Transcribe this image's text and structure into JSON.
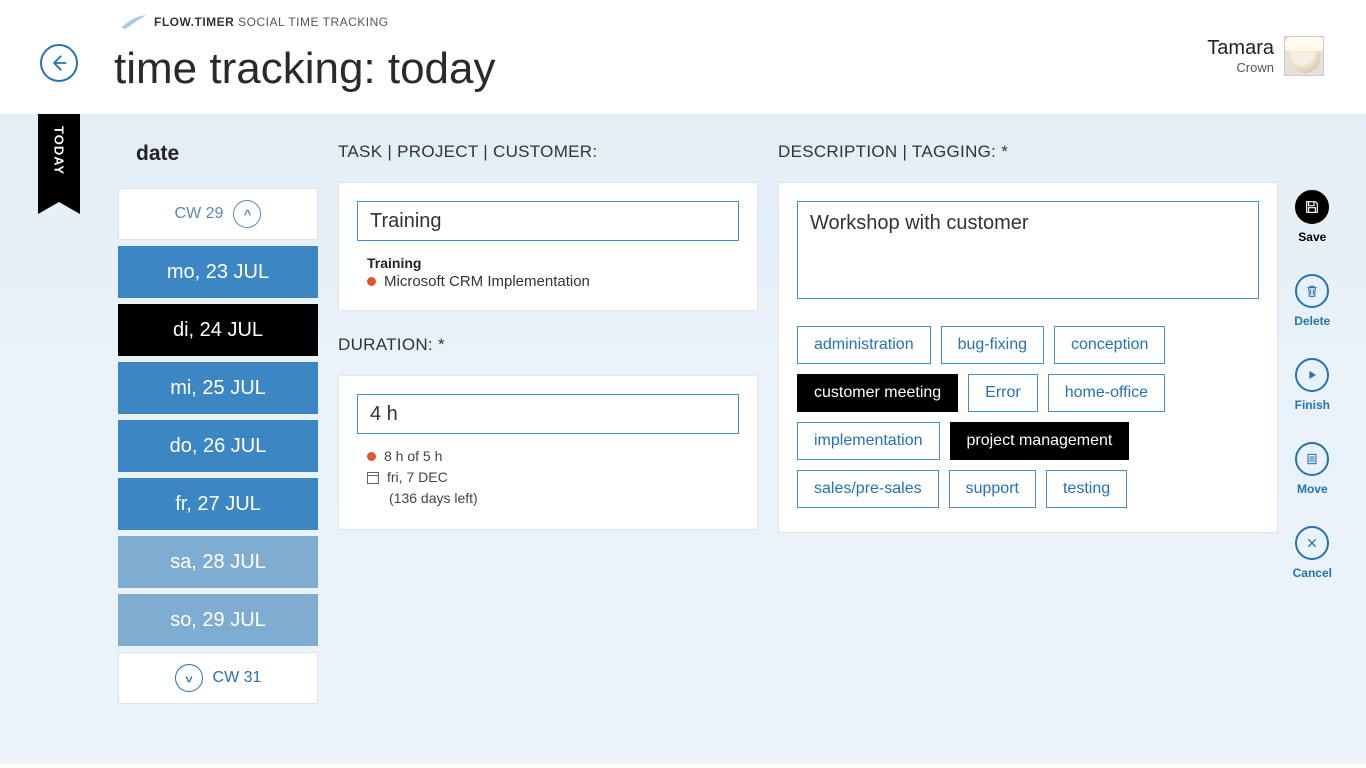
{
  "brand": {
    "name_bold": "FLOW.TIMER",
    "name_light": " SOCIAL TIME TRACKING"
  },
  "page_title": "time tracking: today",
  "user": {
    "name": "Tamara",
    "company": "Crown"
  },
  "today_label": "TODAY",
  "date_section": {
    "heading": "date",
    "prev_week": "CW 29",
    "next_week": "CW 31",
    "days": [
      {
        "label": "mo, 23 JUL",
        "style": "blue"
      },
      {
        "label": "di, 24 JUL",
        "style": "active"
      },
      {
        "label": "mi, 25 JUL",
        "style": "blue"
      },
      {
        "label": "do, 26 JUL",
        "style": "blue"
      },
      {
        "label": "fr, 27 JUL",
        "style": "blue"
      },
      {
        "label": "sa, 28 JUL",
        "style": "light"
      },
      {
        "label": "so, 29 JUL",
        "style": "light"
      }
    ]
  },
  "task_section": {
    "heading": "TASK | PROJECT | CUSTOMER:",
    "input_value": "Training",
    "task_name": "Training",
    "project_name": "Microsoft CRM Implementation"
  },
  "duration_section": {
    "heading": "DURATION: *",
    "input_value": "4 h",
    "budget": "8 h of 5 h",
    "due_date": "fri, 7 DEC",
    "days_left": "(136 days left)"
  },
  "description_section": {
    "heading": "DESCRIPTION | TAGGING: *",
    "text_value": "Workshop with customer",
    "tags": [
      {
        "label": "administration",
        "selected": false
      },
      {
        "label": "bug-fixing",
        "selected": false
      },
      {
        "label": "conception",
        "selected": false
      },
      {
        "label": "customer meeting",
        "selected": true
      },
      {
        "label": "Error",
        "selected": false
      },
      {
        "label": "home-office",
        "selected": false
      },
      {
        "label": "implementation",
        "selected": false
      },
      {
        "label": "project management",
        "selected": true
      },
      {
        "label": "sales/pre-sales",
        "selected": false
      },
      {
        "label": "support",
        "selected": false
      },
      {
        "label": "testing",
        "selected": false
      }
    ]
  },
  "actions": {
    "save": "Save",
    "delete": "Delete",
    "finish": "Finish",
    "move": "Move",
    "cancel": "Cancel"
  }
}
